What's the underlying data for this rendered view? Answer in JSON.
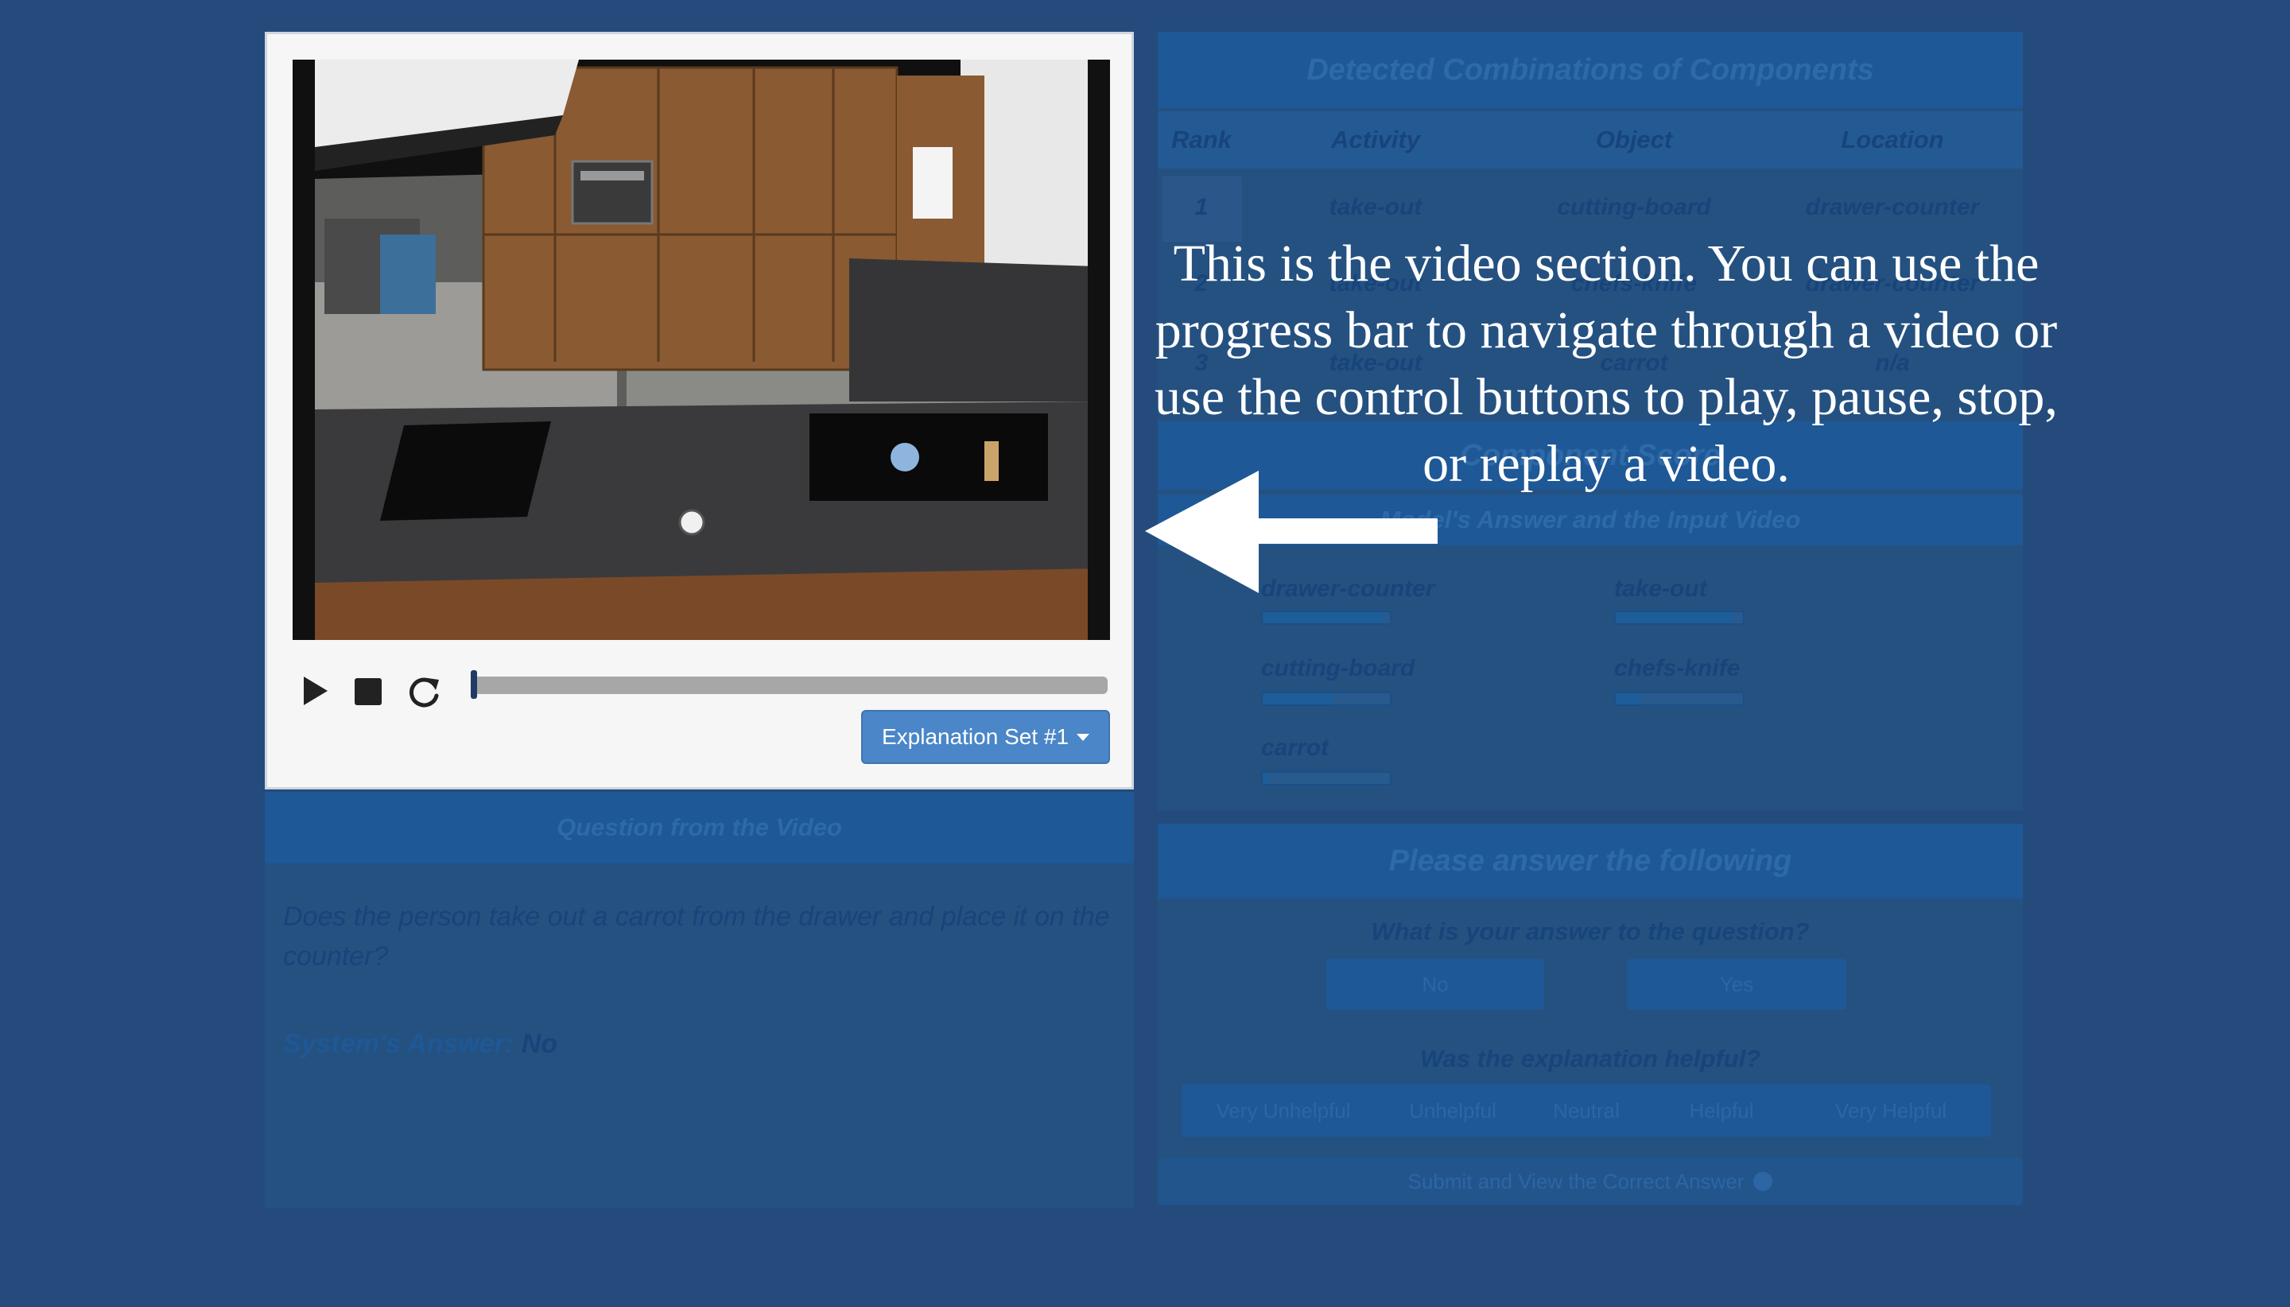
{
  "right_panel": {
    "title": "Detected Combinations of Components",
    "columns": [
      "Rank",
      "Activity",
      "Object",
      "Location"
    ],
    "rows": [
      {
        "rank": "1",
        "activity": "take-out",
        "object": "cutting-board",
        "location": "drawer-counter"
      },
      {
        "rank": "2",
        "activity": "take-out",
        "object": "chefs-knife",
        "location": "drawer-counter"
      },
      {
        "rank": "3",
        "activity": "take-out",
        "object": "carrot",
        "location": "n/a"
      }
    ],
    "component_score_title": "Component Score",
    "component_score_subtitle": "Model's Answer and the Input Video",
    "score_items": [
      {
        "label": "drawer-counter",
        "value": 0.95
      },
      {
        "label": "take-out",
        "value": 0.92
      },
      {
        "label": "cutting-board",
        "value": 0.55
      },
      {
        "label": "chefs-knife",
        "value": 0.2
      },
      {
        "label": "carrot",
        "value": 0.05
      }
    ]
  },
  "question_panel": {
    "title": "Question from the Video",
    "question": "Does the person take out a carrot from the drawer and place it on the counter?",
    "system_answer_label": "System's Answer:",
    "system_answer_value": "No"
  },
  "answer_panel": {
    "title": "Please answer the following",
    "q1": "What is your answer to the question?",
    "no_label": "No",
    "yes_label": "Yes",
    "q2": "Was the explanation helpful?",
    "options": [
      "Very Unhelpful",
      "Unhelpful",
      "Neutral",
      "Helpful",
      "Very Helpful"
    ],
    "submit_label": "Submit and View the Correct Answer"
  },
  "video": {
    "explanation_set_label": "Explanation Set #1",
    "progress": 0.0
  },
  "overlay": {
    "text": "This is the video section. You can use the progress bar to navigate through a video or use the control buttons to play, pause, stop, or replay a video."
  },
  "colors": {
    "background": "#244b7c",
    "accent_button": "#4a86c8",
    "overlay_text": "#ffffff"
  },
  "icons": [
    "play-icon",
    "stop-icon",
    "replay-icon",
    "check-circle-icon",
    "caret-down-icon",
    "arrow-left-icon"
  ]
}
